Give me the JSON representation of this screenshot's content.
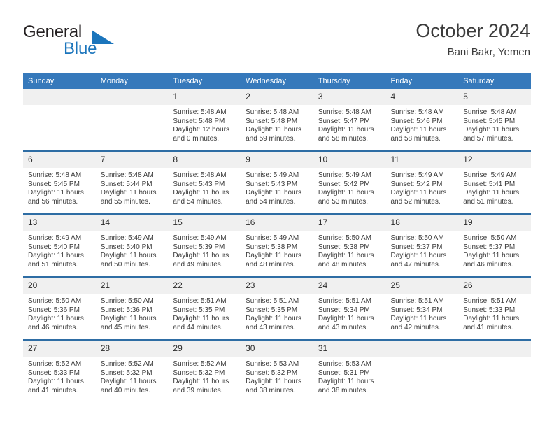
{
  "brand": {
    "name_part1": "General",
    "name_part2": "Blue",
    "triangle_icon": "triangle-icon",
    "accent_color": "#1b75bc"
  },
  "header": {
    "title": "October 2024",
    "subtitle": "Bani Bakr, Yemen"
  },
  "theme": {
    "header_bg": "#3679bb",
    "row_divider": "#2e6da4",
    "daynum_bg": "#f0f0f0",
    "text": "#3a3a3a"
  },
  "weekday_headers": [
    "Sunday",
    "Monday",
    "Tuesday",
    "Wednesday",
    "Thursday",
    "Friday",
    "Saturday"
  ],
  "weeks": [
    [
      {
        "day": "",
        "blank": true
      },
      {
        "day": "",
        "blank": true
      },
      {
        "day": "1",
        "sunrise": "Sunrise: 5:48 AM",
        "sunset": "Sunset: 5:48 PM",
        "daylight_line1": "Daylight: 12 hours",
        "daylight_line2": "and 0 minutes."
      },
      {
        "day": "2",
        "sunrise": "Sunrise: 5:48 AM",
        "sunset": "Sunset: 5:48 PM",
        "daylight_line1": "Daylight: 11 hours",
        "daylight_line2": "and 59 minutes."
      },
      {
        "day": "3",
        "sunrise": "Sunrise: 5:48 AM",
        "sunset": "Sunset: 5:47 PM",
        "daylight_line1": "Daylight: 11 hours",
        "daylight_line2": "and 58 minutes."
      },
      {
        "day": "4",
        "sunrise": "Sunrise: 5:48 AM",
        "sunset": "Sunset: 5:46 PM",
        "daylight_line1": "Daylight: 11 hours",
        "daylight_line2": "and 58 minutes."
      },
      {
        "day": "5",
        "sunrise": "Sunrise: 5:48 AM",
        "sunset": "Sunset: 5:45 PM",
        "daylight_line1": "Daylight: 11 hours",
        "daylight_line2": "and 57 minutes."
      }
    ],
    [
      {
        "day": "6",
        "sunrise": "Sunrise: 5:48 AM",
        "sunset": "Sunset: 5:45 PM",
        "daylight_line1": "Daylight: 11 hours",
        "daylight_line2": "and 56 minutes."
      },
      {
        "day": "7",
        "sunrise": "Sunrise: 5:48 AM",
        "sunset": "Sunset: 5:44 PM",
        "daylight_line1": "Daylight: 11 hours",
        "daylight_line2": "and 55 minutes."
      },
      {
        "day": "8",
        "sunrise": "Sunrise: 5:48 AM",
        "sunset": "Sunset: 5:43 PM",
        "daylight_line1": "Daylight: 11 hours",
        "daylight_line2": "and 54 minutes."
      },
      {
        "day": "9",
        "sunrise": "Sunrise: 5:49 AM",
        "sunset": "Sunset: 5:43 PM",
        "daylight_line1": "Daylight: 11 hours",
        "daylight_line2": "and 54 minutes."
      },
      {
        "day": "10",
        "sunrise": "Sunrise: 5:49 AM",
        "sunset": "Sunset: 5:42 PM",
        "daylight_line1": "Daylight: 11 hours",
        "daylight_line2": "and 53 minutes."
      },
      {
        "day": "11",
        "sunrise": "Sunrise: 5:49 AM",
        "sunset": "Sunset: 5:42 PM",
        "daylight_line1": "Daylight: 11 hours",
        "daylight_line2": "and 52 minutes."
      },
      {
        "day": "12",
        "sunrise": "Sunrise: 5:49 AM",
        "sunset": "Sunset: 5:41 PM",
        "daylight_line1": "Daylight: 11 hours",
        "daylight_line2": "and 51 minutes."
      }
    ],
    [
      {
        "day": "13",
        "sunrise": "Sunrise: 5:49 AM",
        "sunset": "Sunset: 5:40 PM",
        "daylight_line1": "Daylight: 11 hours",
        "daylight_line2": "and 51 minutes."
      },
      {
        "day": "14",
        "sunrise": "Sunrise: 5:49 AM",
        "sunset": "Sunset: 5:40 PM",
        "daylight_line1": "Daylight: 11 hours",
        "daylight_line2": "and 50 minutes."
      },
      {
        "day": "15",
        "sunrise": "Sunrise: 5:49 AM",
        "sunset": "Sunset: 5:39 PM",
        "daylight_line1": "Daylight: 11 hours",
        "daylight_line2": "and 49 minutes."
      },
      {
        "day": "16",
        "sunrise": "Sunrise: 5:49 AM",
        "sunset": "Sunset: 5:38 PM",
        "daylight_line1": "Daylight: 11 hours",
        "daylight_line2": "and 48 minutes."
      },
      {
        "day": "17",
        "sunrise": "Sunrise: 5:50 AM",
        "sunset": "Sunset: 5:38 PM",
        "daylight_line1": "Daylight: 11 hours",
        "daylight_line2": "and 48 minutes."
      },
      {
        "day": "18",
        "sunrise": "Sunrise: 5:50 AM",
        "sunset": "Sunset: 5:37 PM",
        "daylight_line1": "Daylight: 11 hours",
        "daylight_line2": "and 47 minutes."
      },
      {
        "day": "19",
        "sunrise": "Sunrise: 5:50 AM",
        "sunset": "Sunset: 5:37 PM",
        "daylight_line1": "Daylight: 11 hours",
        "daylight_line2": "and 46 minutes."
      }
    ],
    [
      {
        "day": "20",
        "sunrise": "Sunrise: 5:50 AM",
        "sunset": "Sunset: 5:36 PM",
        "daylight_line1": "Daylight: 11 hours",
        "daylight_line2": "and 46 minutes."
      },
      {
        "day": "21",
        "sunrise": "Sunrise: 5:50 AM",
        "sunset": "Sunset: 5:36 PM",
        "daylight_line1": "Daylight: 11 hours",
        "daylight_line2": "and 45 minutes."
      },
      {
        "day": "22",
        "sunrise": "Sunrise: 5:51 AM",
        "sunset": "Sunset: 5:35 PM",
        "daylight_line1": "Daylight: 11 hours",
        "daylight_line2": "and 44 minutes."
      },
      {
        "day": "23",
        "sunrise": "Sunrise: 5:51 AM",
        "sunset": "Sunset: 5:35 PM",
        "daylight_line1": "Daylight: 11 hours",
        "daylight_line2": "and 43 minutes."
      },
      {
        "day": "24",
        "sunrise": "Sunrise: 5:51 AM",
        "sunset": "Sunset: 5:34 PM",
        "daylight_line1": "Daylight: 11 hours",
        "daylight_line2": "and 43 minutes."
      },
      {
        "day": "25",
        "sunrise": "Sunrise: 5:51 AM",
        "sunset": "Sunset: 5:34 PM",
        "daylight_line1": "Daylight: 11 hours",
        "daylight_line2": "and 42 minutes."
      },
      {
        "day": "26",
        "sunrise": "Sunrise: 5:51 AM",
        "sunset": "Sunset: 5:33 PM",
        "daylight_line1": "Daylight: 11 hours",
        "daylight_line2": "and 41 minutes."
      }
    ],
    [
      {
        "day": "27",
        "sunrise": "Sunrise: 5:52 AM",
        "sunset": "Sunset: 5:33 PM",
        "daylight_line1": "Daylight: 11 hours",
        "daylight_line2": "and 41 minutes."
      },
      {
        "day": "28",
        "sunrise": "Sunrise: 5:52 AM",
        "sunset": "Sunset: 5:32 PM",
        "daylight_line1": "Daylight: 11 hours",
        "daylight_line2": "and 40 minutes."
      },
      {
        "day": "29",
        "sunrise": "Sunrise: 5:52 AM",
        "sunset": "Sunset: 5:32 PM",
        "daylight_line1": "Daylight: 11 hours",
        "daylight_line2": "and 39 minutes."
      },
      {
        "day": "30",
        "sunrise": "Sunrise: 5:53 AM",
        "sunset": "Sunset: 5:32 PM",
        "daylight_line1": "Daylight: 11 hours",
        "daylight_line2": "and 38 minutes."
      },
      {
        "day": "31",
        "sunrise": "Sunrise: 5:53 AM",
        "sunset": "Sunset: 5:31 PM",
        "daylight_line1": "Daylight: 11 hours",
        "daylight_line2": "and 38 minutes."
      },
      {
        "day": "",
        "blank": true
      },
      {
        "day": "",
        "blank": true
      }
    ]
  ]
}
